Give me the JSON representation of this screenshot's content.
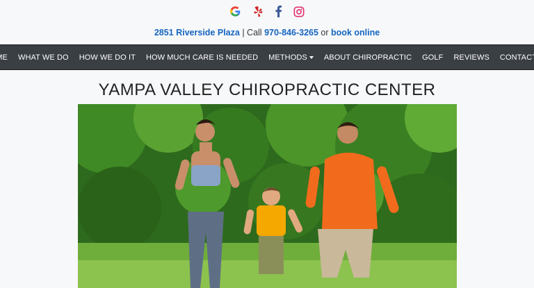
{
  "header": {
    "social_icons": [
      "google-icon",
      "yelp-icon",
      "facebook-icon",
      "instagram-icon"
    ],
    "address": "2851 Riverside Plaza",
    "call_text": "Call",
    "phone": "970-846-3265",
    "or_text": "or",
    "book_label": "book online"
  },
  "nav": {
    "items": [
      "HOME",
      "WHAT WE DO",
      "HOW WE DO IT",
      "HOW MUCH CARE IS NEEDED",
      "METHODS",
      "ABOUT CHIROPRACTIC",
      "GOLF",
      "REVIEWS",
      "CONTACT US"
    ]
  },
  "main": {
    "title": "YAMPA VALLEY CHIROPRACTIC CENTER"
  },
  "colors": {
    "nav_bg": "#3a3f44",
    "link": "#1565c0",
    "page_bg": "#f7f8fa"
  }
}
